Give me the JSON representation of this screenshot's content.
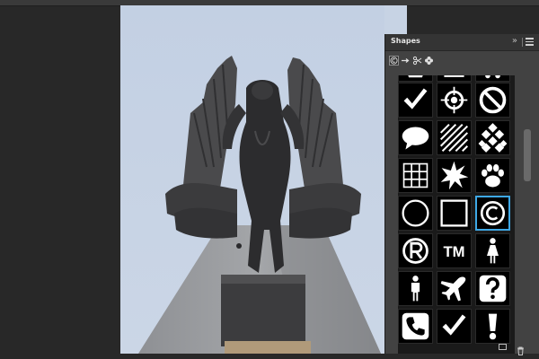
{
  "panel": {
    "title": "Shapes",
    "collapse_glyph": "»",
    "toolbar": [
      "copyright-icon",
      "arrow-right-icon",
      "scissors-icon",
      "flower-icon"
    ],
    "selected_shape": "copyright",
    "shapes": [
      "partial-top-1",
      "partial-top-2",
      "partial-top-3",
      "checkmark",
      "target",
      "no-symbol",
      "speech-bubble",
      "diagonal-hatch",
      "checkerboard",
      "grid",
      "starburst",
      "paw-print",
      "circle-frame",
      "square-frame",
      "copyright",
      "registered",
      "trademark",
      "female-figure",
      "male-figure",
      "airplane",
      "help",
      "telephone",
      "checkmark",
      "exclamation"
    ],
    "trademark_text": "TM",
    "bottom_actions": [
      "new-group-icon",
      "trash-icon"
    ]
  },
  "colors": {
    "workspace": "#282828",
    "panel": "#424242",
    "selection": "#3ea8e6",
    "sky": "#c7d3e4"
  }
}
